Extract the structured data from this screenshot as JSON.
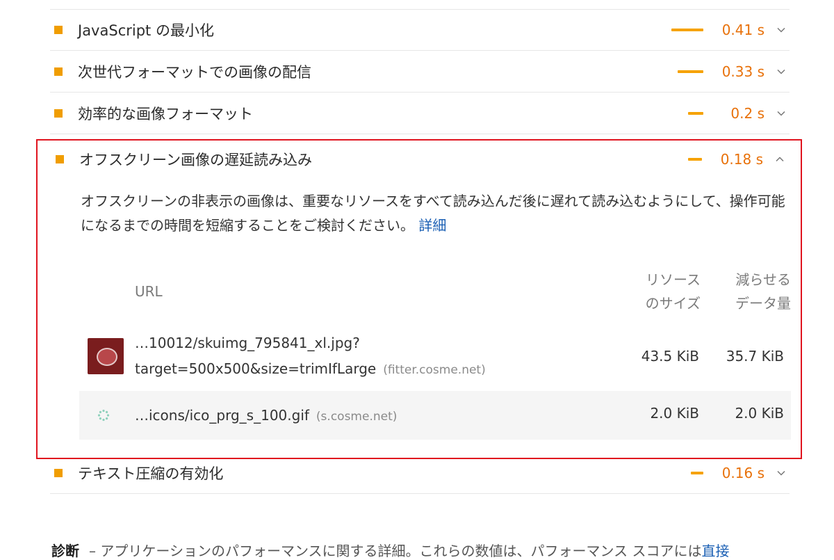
{
  "audits": [
    {
      "title": "JavaScript の最小化",
      "value": "0.41 s",
      "bar_fraction": 0.41,
      "expanded": false
    },
    {
      "title": "次世代フォーマットでの画像の配信",
      "value": "0.33 s",
      "bar_fraction": 0.33,
      "expanded": false
    },
    {
      "title": "効率的な画像フォーマット",
      "value": "0.2 s",
      "bar_fraction": 0.2,
      "expanded": false
    },
    {
      "title": "オフスクリーン画像の遅延読み込み",
      "value": "0.18 s",
      "bar_fraction": 0.18,
      "expanded": true
    },
    {
      "title": "テキスト圧縮の有効化",
      "value": "0.16 s",
      "bar_fraction": 0.16,
      "expanded": false
    }
  ],
  "detail": {
    "description": "オフスクリーンの非表示の画像は、重要なリソースをすべて読み込んだ後に遅れて読み込むようにして、操作可能になるまでの時間を短縮することをご検討ください。",
    "learn_more": "詳細",
    "columns": {
      "url": "URL",
      "size_line1": "リソース",
      "size_line2": "のサイズ",
      "savings_line1": "減らせる",
      "savings_line2": "データ量"
    },
    "rows": [
      {
        "url_line1": "…10012/skuimg_795841_xl.jpg?",
        "url_line2": "target=500x500&size=trimIfLarge",
        "host": "(fitter.cosme.net)",
        "size": "43.5 KiB",
        "savings": "35.7 KiB",
        "icon": "product-thumbnail"
      },
      {
        "url_line1": "…icons/ico_prg_s_100.gif",
        "host": "(s.cosme.net)",
        "size": "2.0 KiB",
        "savings": "2.0 KiB",
        "icon": "loading-spinner-icon"
      }
    ]
  },
  "diagnostics": {
    "heading": "診断",
    "text": "– アプリケーションのパフォーマンスに関する詳細。これらの数値は、パフォーマンス スコアには",
    "link": "直接"
  },
  "colors": {
    "average_orange": "#f09d00",
    "value_orange": "#e8710a",
    "highlight_red": "#e0141e",
    "link_blue": "#1a5fb4"
  }
}
